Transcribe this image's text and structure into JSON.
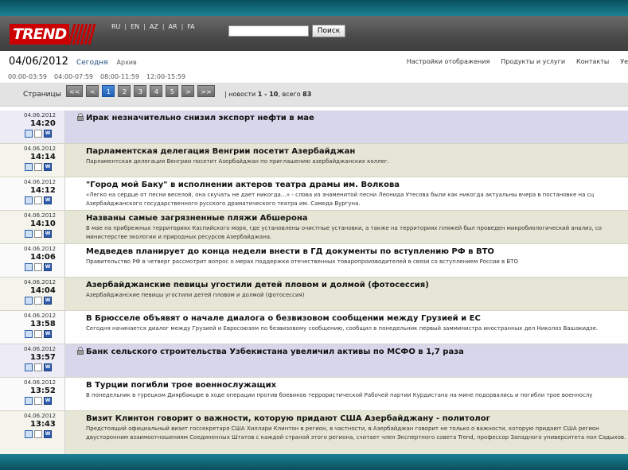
{
  "logo": {
    "text": "TREND"
  },
  "languages": [
    "RU",
    "EN",
    "AZ",
    "AR",
    "FA"
  ],
  "search": {
    "value": "",
    "button": "Поиск"
  },
  "datebar": {
    "date": "04/06/2012",
    "today": "Сегодня",
    "archive": "Архив"
  },
  "nav": [
    "Настройки отображения",
    "Продукты и услуги",
    "Контакты",
    "Уе"
  ],
  "time_ranges": [
    "00:00-03:59",
    "04:00-07:59",
    "08:00-11:59",
    "12:00-15:59"
  ],
  "pager": {
    "label": "Страницы",
    "buttons": [
      "<<",
      "<",
      "1",
      "2",
      "3",
      "4",
      "5",
      ">",
      ">>"
    ],
    "active": "1",
    "summary_prefix": "| новости",
    "summary_range": "1 - 10",
    "summary_suffix": ", всего",
    "summary_total": "83"
  },
  "news": [
    {
      "date": "04.06.2012",
      "time": "14:20",
      "locked": true,
      "bg": "purple",
      "title": "Ирак незначительно снизил экспорт нефти в мае",
      "summary": ""
    },
    {
      "date": "04.06.2012",
      "time": "14:14",
      "locked": false,
      "bg": "green",
      "title": "Парламентская делегация Венгрии посетит Азербайджан",
      "summary": "Парламентская делегация Венгрии посетит Азербайджан по приглашению азербайджанских коллег."
    },
    {
      "date": "04.06.2012",
      "time": "14:12",
      "locked": false,
      "bg": "white",
      "title": "\"Город мой Баку\" в исполнении актеров театра драмы им. Волкова",
      "summary": "«Легко на сердце от песни веселой, она скучать не дает никогда…» - слова из знаменитой песни Леонида Утесова были как никогда актуальны вчера в постановке на сц Азербайджанского государственного русского драматического театра им. Самеда Вургуна."
    },
    {
      "date": "04.06.2012",
      "time": "14:10",
      "locked": false,
      "bg": "green",
      "title": "Названы самые загрязненные пляжи Абшерона",
      "summary": "В мае на прибрежных территориях Каспийского моря, где установлены очистные установки, а также на территориях пляжей был проведен микробиологический анализ, со министерстве экологии и природных ресурсов Азербайджана."
    },
    {
      "date": "04.06.2012",
      "time": "14:06",
      "locked": false,
      "bg": "white",
      "title": "Медведев планирует до конца недели внести в ГД документы по вступлению РФ в ВТО",
      "summary": "Правительство РФ в четверг рассмотрит вопрос о мерах поддержки отечественных товаропроизводителей в связи со вступлением России в ВТО"
    },
    {
      "date": "04.06.2012",
      "time": "14:04",
      "locked": false,
      "bg": "green",
      "title": "Азербайджанские певицы угостили детей пловом и долмой (фотосессия)",
      "summary": "Азербайджанские певицы угостили детей пловом и долмой (фотосессия)"
    },
    {
      "date": "04.06.2012",
      "time": "13:58",
      "locked": false,
      "bg": "white",
      "title": "В Брюсселе объявят о начале диалога о безвизовом сообщении между Грузией и ЕС",
      "summary": "Сегодня начинается диалог между Грузией и Евросоюзом по безвизовому сообщению, сообщил в понедельник первый замминистра иностранных дел Николоз Вашакидзе."
    },
    {
      "date": "04.06.2012",
      "time": "13:57",
      "locked": true,
      "bg": "purple",
      "title": "Банк сельского строительства Узбекистана увеличил активы по МСФО в 1,7 раза",
      "summary": ""
    },
    {
      "date": "04.06.2012",
      "time": "13:52",
      "locked": false,
      "bg": "white",
      "title": "В Турции погибли трое военнослужащих",
      "summary": "В понедельник в турецком Диярбакыре в ходе операции против боевиков террористической Рабочей партии Курдистана на мине подорвались и погибли трое военнослу"
    },
    {
      "date": "04.06.2012",
      "time": "13:43",
      "locked": false,
      "bg": "green",
      "tall": true,
      "title": "Визит Клинтон говорит о важности, которую придают США Азербайджану - политолог",
      "summary": "Предстоящий официальный визит госсекретаря США Хиллари Клинтон в регион, в частности, в Азербайджан говорит не только о важности, которую придают США регион двусторонним взаимоотношениям Соединенных Штатов с каждой страной этого региона, считает член Экспертного совета Trend, профессор Западного университета пол Садыхов."
    }
  ]
}
